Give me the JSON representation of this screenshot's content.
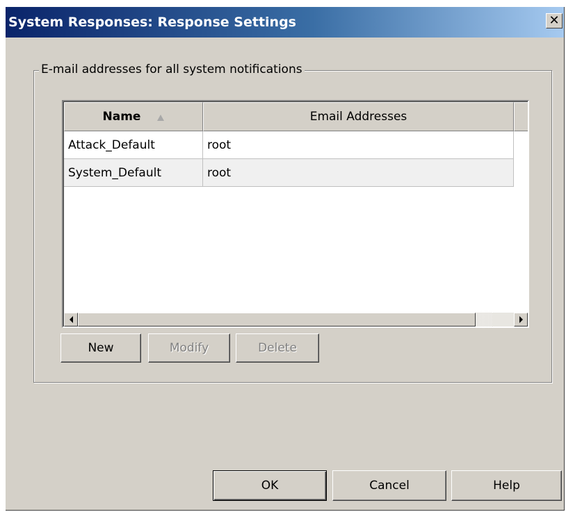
{
  "window": {
    "title": "System Responses: Response Settings",
    "close_glyph": "✕"
  },
  "group": {
    "label": "E-mail addresses for all system notifications"
  },
  "table": {
    "columns": [
      "Name",
      "Email Addresses"
    ],
    "sort_indicator": "ascending",
    "rows": [
      {
        "name": "Attack_Default",
        "email": "root"
      },
      {
        "name": "System_Default",
        "email": "root"
      }
    ]
  },
  "table_buttons": {
    "new_label": "New",
    "modify_label": "Modify",
    "delete_label": "Delete"
  },
  "dialog_buttons": {
    "ok_label": "OK",
    "cancel_label": "Cancel",
    "help_label": "Help"
  },
  "colors": {
    "title_gradient_start": "#0a246a",
    "title_gradient_end": "#a6caf0",
    "face": "#d4d0c8",
    "alt_row": "#f0f0f0"
  }
}
